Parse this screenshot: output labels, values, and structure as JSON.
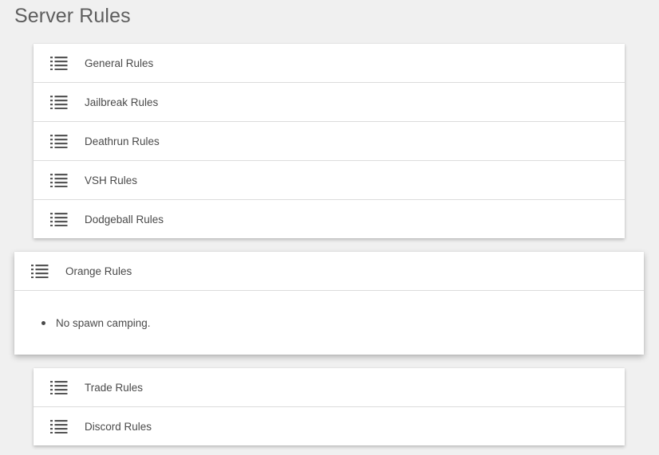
{
  "page": {
    "title": "Server Rules"
  },
  "rules_top": [
    {
      "label": "General Rules",
      "icon": "list-icon"
    },
    {
      "label": "Jailbreak Rules",
      "icon": "list-icon"
    },
    {
      "label": "Deathrun Rules",
      "icon": "list-icon"
    },
    {
      "label": "VSH Rules",
      "icon": "list-icon"
    },
    {
      "label": "Dodgeball Rules",
      "icon": "list-icon"
    }
  ],
  "rules_expanded": {
    "label": "Orange Rules",
    "icon": "list-icon",
    "items": [
      "No spawn camping."
    ]
  },
  "rules_bottom": [
    {
      "label": "Trade Rules",
      "icon": "list-icon"
    },
    {
      "label": "Discord Rules",
      "icon": "list-icon"
    }
  ],
  "colors": {
    "background": "#f0f0f0",
    "card": "#ffffff",
    "divider": "#dcdcdc",
    "text": "#4a4a4a",
    "title": "#5e5e5e"
  }
}
